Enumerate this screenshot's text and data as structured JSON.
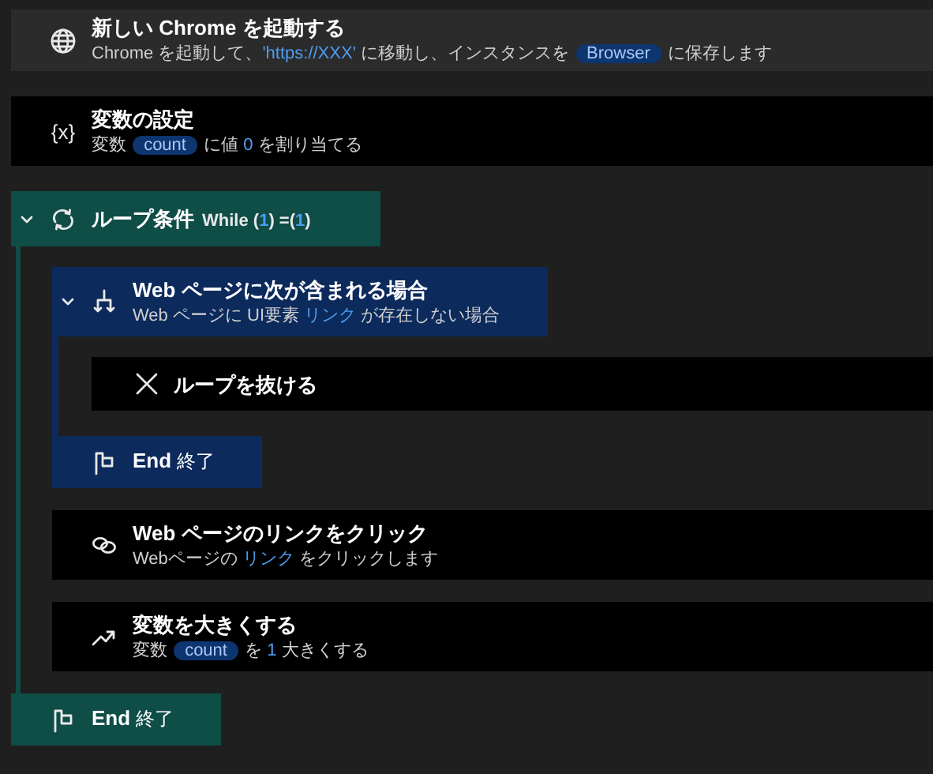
{
  "steps": [
    {
      "kind": "launch-browser",
      "selected": true,
      "title": "新しい Chrome を起動する",
      "description": [
        {
          "kind": "text",
          "text": "Chrome を起動して、"
        },
        {
          "kind": "value",
          "text": "'https://XXX'"
        },
        {
          "kind": "text",
          "text": " に移動し、インスタンスを "
        },
        {
          "kind": "variable",
          "text": "Browser"
        },
        {
          "kind": "text",
          "text": " に保存します"
        }
      ]
    },
    {
      "kind": "set-variable",
      "selected": false,
      "icon_glyph": "{x}",
      "title": "変数の設定",
      "description": [
        {
          "kind": "text",
          "text": "変数 "
        },
        {
          "kind": "variable",
          "text": "count"
        },
        {
          "kind": "text",
          "text": " に値 "
        },
        {
          "kind": "value",
          "text": "0"
        },
        {
          "kind": "text",
          "text": " を割り当てる"
        }
      ]
    },
    {
      "kind": "loop",
      "selected": false,
      "expanded": true,
      "title": "ループ条件",
      "condition": [
        {
          "kind": "text",
          "text": "While ("
        },
        {
          "kind": "value",
          "text": "1"
        },
        {
          "kind": "text",
          "text": ") =("
        },
        {
          "kind": "value",
          "text": "1"
        },
        {
          "kind": "text",
          "text": ")"
        }
      ],
      "children": [
        {
          "kind": "if-web-page",
          "selected": false,
          "expanded": true,
          "title": "Web ページに次が含まれる場合",
          "description": [
            {
              "kind": "text",
              "text": "Web ページに UI要素 "
            },
            {
              "kind": "value",
              "text": "リンク"
            },
            {
              "kind": "text",
              "text": " が存在しない場合"
            }
          ],
          "children": [
            {
              "kind": "exit-loop",
              "selected": false,
              "title": "ループを抜ける"
            }
          ],
          "end": {
            "keyword": "End",
            "label": "終了"
          }
        },
        {
          "kind": "click-link",
          "selected": false,
          "title": "Web ページのリンクをクリック",
          "description": [
            {
              "kind": "text",
              "text": "Webページの "
            },
            {
              "kind": "value",
              "text": "リンク"
            },
            {
              "kind": "text",
              "text": " をクリックします"
            }
          ]
        },
        {
          "kind": "increase-variable",
          "selected": false,
          "title": "変数を大きくする",
          "description": [
            {
              "kind": "text",
              "text": "変数 "
            },
            {
              "kind": "variable",
              "text": "count"
            },
            {
              "kind": "text",
              "text": " を "
            },
            {
              "kind": "value",
              "text": "1"
            },
            {
              "kind": "text",
              "text": " 大きくする"
            }
          ]
        }
      ],
      "end": {
        "keyword": "End",
        "label": "終了"
      }
    }
  ]
}
